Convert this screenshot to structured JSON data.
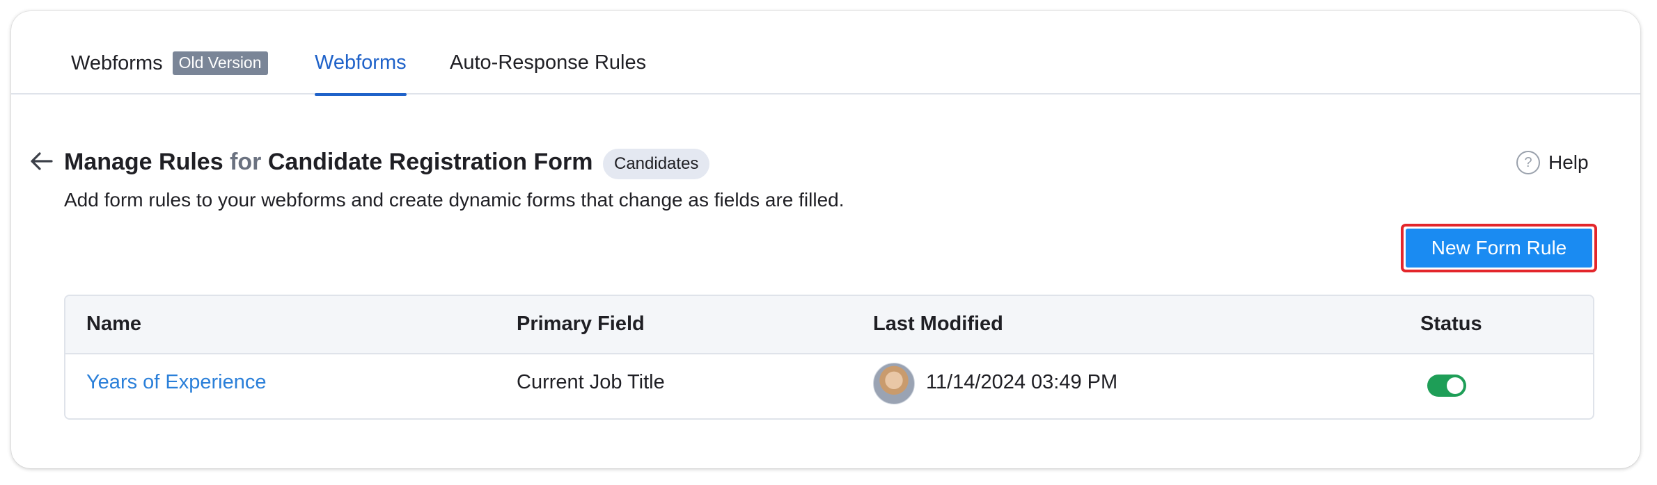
{
  "tabs": {
    "webforms_old": {
      "label": "Webforms",
      "badge": "Old Version"
    },
    "webforms": {
      "label": "Webforms"
    },
    "auto_response": {
      "label": "Auto-Response Rules"
    }
  },
  "header": {
    "title_part1": "Manage Rules",
    "title_for": "for",
    "title_part2": "Candidate Registration Form",
    "module_badge": "Candidates",
    "subtitle": "Add form rules to your webforms and create dynamic forms that change as fields are filled.",
    "help_icon_glyph": "?",
    "help_label": "Help"
  },
  "toolbar": {
    "new_rule_label": "New Form Rule"
  },
  "table": {
    "columns": [
      "Name",
      "Primary Field",
      "Last Modified",
      "Status"
    ],
    "rows": [
      {
        "name": "Years of Experience",
        "primary_field": "Current Job Title",
        "last_modified": "11/14/2024 03:49 PM",
        "status_enabled": true
      }
    ]
  },
  "colors": {
    "accent_blue": "#1f62c9",
    "button_blue": "#1a8bf2",
    "highlight_red": "#e3262b",
    "toggle_green": "#1e9e57",
    "link_blue": "#2a7fd9"
  }
}
